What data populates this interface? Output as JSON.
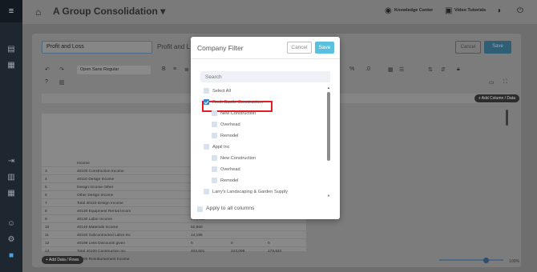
{
  "header": {
    "title": "A Group Consolidation",
    "knowledge_center": "Knowledge Center",
    "video_tutorials": "Video Tutorials"
  },
  "workspace": {
    "report_name": "Profit and Loss",
    "report_sub": "Profit and L",
    "cancel_label": "Cancel",
    "save_label": "Save",
    "font_select": "Open Sans Regular",
    "add_column_label": "+ Add Column / Data",
    "add_row_label": "+ Add Data / Rows",
    "zoom": "100%",
    "grid_rows": [
      [
        "",
        "",
        "",
        "Income",
        "",
        "",
        ""
      ],
      [
        "3",
        "",
        "",
        "40100 Construction Income",
        "",
        "",
        ""
      ],
      [
        "4",
        "",
        "",
        "40110 Design Income",
        "114,230",
        "",
        ""
      ],
      [
        "5",
        "",
        "",
        "Design Income Other",
        "0",
        "",
        ""
      ],
      [
        "6",
        "",
        "",
        "Other Design Income",
        "0",
        "",
        ""
      ],
      [
        "7",
        "",
        "",
        "Total 40110 Design Income",
        "114,230",
        "",
        ""
      ],
      [
        "8",
        "",
        "",
        "40130 Equipment Rental Incom",
        "26,588",
        "",
        ""
      ],
      [
        "9",
        "",
        "",
        "40130 Labor Income",
        "195,655",
        "",
        ""
      ],
      [
        "10",
        "",
        "",
        "40140 Materials Income",
        "52,860",
        "",
        ""
      ],
      [
        "11",
        "",
        "",
        "40150 Subcontracted Labor Inc",
        "14,195",
        "",
        ""
      ],
      [
        "12",
        "",
        "",
        "40199 Less Discounts given",
        "0",
        "0",
        "0"
      ],
      [
        "13",
        "",
        "",
        "Total 40100 Construction Inc",
        "403,601",
        "223,099",
        "179,822"
      ],
      [
        "14",
        "",
        "",
        "40500 Reimbursement Income",
        "",
        "",
        ""
      ]
    ]
  },
  "modal": {
    "title": "Company Filter",
    "cancel_label": "Cancel",
    "save_label": "Save",
    "search_placeholder": "Search",
    "items": [
      {
        "label": "Select All",
        "level": 0,
        "checked": false
      },
      {
        "label": "Rock Castle Construction",
        "level": 0,
        "checked": true
      },
      {
        "label": "New Construction",
        "level": 1,
        "checked": false
      },
      {
        "label": "Overhead",
        "level": 1,
        "checked": false
      },
      {
        "label": "Remodel",
        "level": 1,
        "checked": false
      },
      {
        "label": "Appil Inc",
        "level": 0,
        "checked": false
      },
      {
        "label": "New Construction",
        "level": 1,
        "checked": false
      },
      {
        "label": "Overhead",
        "level": 1,
        "checked": false
      },
      {
        "label": "Remodel",
        "level": 1,
        "checked": false
      },
      {
        "label": "Larry's Landscaping & Garden Supply",
        "level": 0,
        "checked": false
      }
    ],
    "apply_all_label": "Apply to all columns",
    "apply_all_checked": false
  },
  "colors": {
    "save": "#5bc0de",
    "checked": "#3d86c6",
    "highlight": "#e31e24"
  }
}
